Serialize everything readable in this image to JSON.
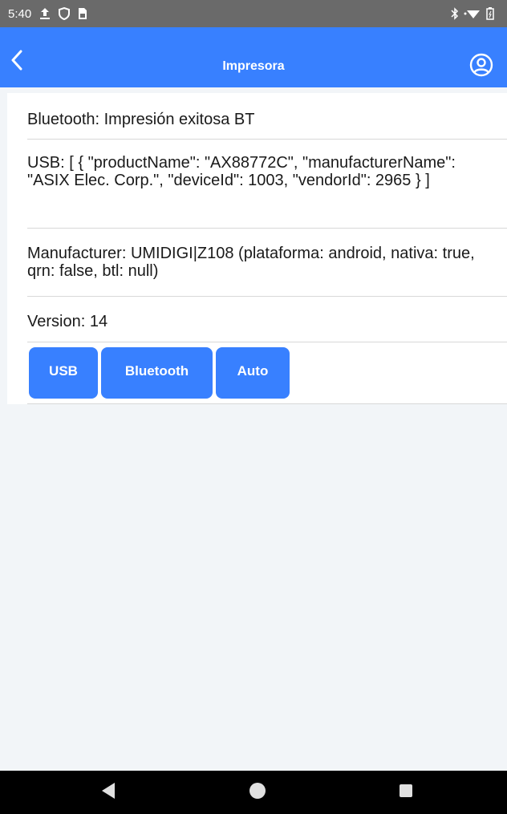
{
  "status_bar": {
    "time": "5:40",
    "icons_left": [
      "upload-icon",
      "shield-icon",
      "sim-icon"
    ],
    "icons_right": [
      "bluetooth-icon",
      "wifi-icon",
      "battery-icon"
    ]
  },
  "header": {
    "title": "Impresora",
    "back_icon": "chevron-left-icon",
    "profile_icon": "person-circle-icon",
    "color": "#3880ff"
  },
  "info": {
    "bluetooth": "Bluetooth: Impresión exitosa BT",
    "usb": "USB: [ { \"productName\": \"AX88772C\", \"manufacturerName\": \"ASIX Elec. Corp.\", \"deviceId\": 1003, \"vendorId\": 2965 } ]",
    "manufacturer": "Manufacturer: UMIDIGI|Z108 (plataforma: android, nativa: true, qrn: false, btl: null)",
    "version": "Version: 14"
  },
  "buttons": {
    "usb": "USB",
    "bluetooth": "Bluetooth",
    "auto": "Auto"
  },
  "nav": {
    "back_icon": "triangle-back-icon",
    "home_icon": "circle-home-icon",
    "recent_icon": "square-recent-icon"
  }
}
